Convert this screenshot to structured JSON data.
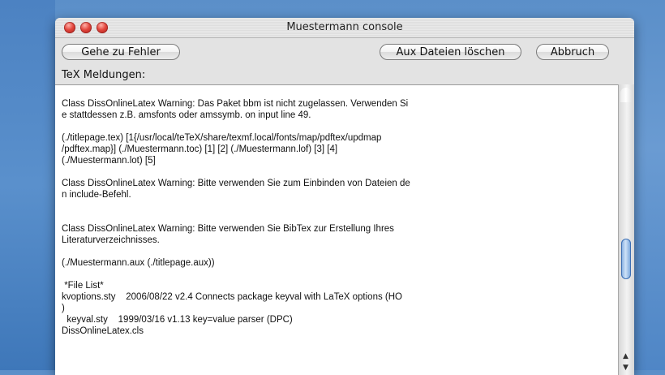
{
  "window": {
    "title": "Muestermann console"
  },
  "toolbar": {
    "goto_label": "Gehe zu Fehler",
    "aux_label": "Aux Dateien löschen",
    "cancel_label": "Abbruch"
  },
  "output_label": "TeX Meldungen:",
  "log_lines": [
    "Class DissOnlineLatex Warning: Das Paket bbm ist nicht zugelassen. Verwenden Si",
    "e stattdessen z.B. amsfonts oder amssymb. on input line 49.",
    "",
    "(./titlepage.tex) [1{/usr/local/teTeX/share/texmf.local/fonts/map/pdftex/updmap",
    "/pdftex.map}] (./Muestermann.toc) [1] [2] (./Muestermann.lof) [3] [4]",
    "(./Muestermann.lot) [5]",
    "",
    "Class DissOnlineLatex Warning: Bitte verwenden Sie zum Einbinden von Dateien de",
    "n include-Befehl.",
    "",
    "",
    "Class DissOnlineLatex Warning: Bitte verwenden Sie BibTex zur Erstellung Ihres",
    "Literaturverzeichnisses.",
    "",
    "(./Muestermann.aux (./titlepage.aux))",
    "",
    " *File List*",
    "kvoptions.sty    2006/08/22 v2.4 Connects package keyval with LaTeX options (HO",
    ")",
    "  keyval.sty    1999/03/16 v1.13 key=value parser (DPC)",
    "DissOnlineLatex.cls"
  ]
}
